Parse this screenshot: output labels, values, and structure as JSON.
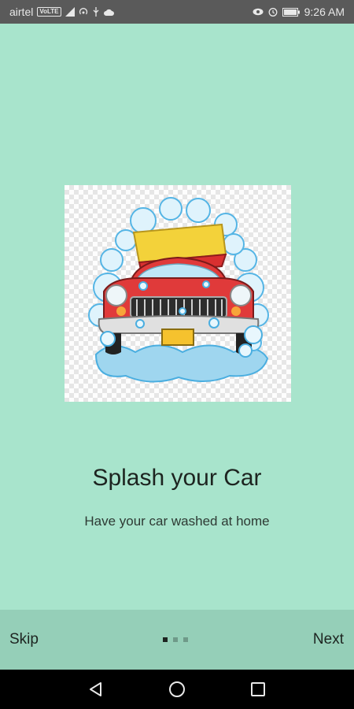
{
  "status_bar": {
    "carrier": "airtel",
    "network_badge": "VoLTE",
    "time": "9:26 AM",
    "icons_left": [
      "volte-icon",
      "signal-icon",
      "hotspot-icon",
      "usb-icon",
      "cloud-icon"
    ],
    "icons_right": [
      "eye-icon",
      "alarm-icon",
      "battery-icon"
    ]
  },
  "onboarding": {
    "illustration": "car-wash-illustration",
    "title": "Splash your Car",
    "subtitle": "Have your car washed at home",
    "page_count": 3,
    "current_page": 1
  },
  "nav": {
    "skip_label": "Skip",
    "next_label": "Next"
  },
  "system_nav": {
    "buttons": [
      "back-icon",
      "home-icon",
      "recents-icon"
    ]
  },
  "colors": {
    "background": "#a8e4cc",
    "bottom_bar": "#95cfb8",
    "status_bar": "#5a5a5a",
    "text": "#1d2420"
  }
}
